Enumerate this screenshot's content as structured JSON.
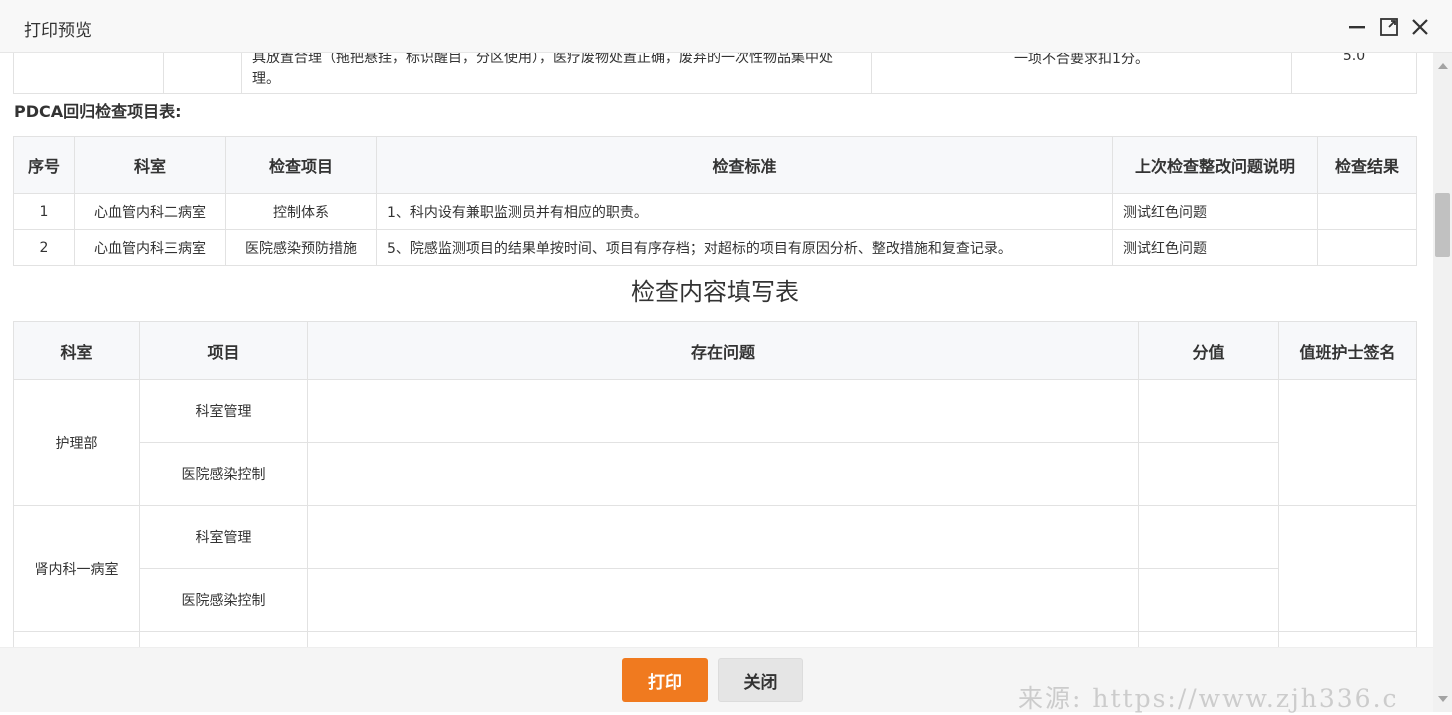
{
  "dialog": {
    "title": "打印预览"
  },
  "top_table": {
    "row": {
      "standard": "具放置合理（拖把悬挂，标识醒目，分区使用），医疗废物处置正确，废弃的一次性物品集中处理。",
      "rule": "一项不合要求扣1分。",
      "score": "5.0"
    }
  },
  "pdca": {
    "title": "PDCA回归检查项目表:",
    "headers": [
      "序号",
      "科室",
      "检查项目",
      "检查标准",
      "上次检查整改问题说明",
      "检查结果"
    ],
    "rows": [
      {
        "no": "1",
        "dept": "心血管内科二病室",
        "item": "控制体系",
        "standard": "1、科内设有兼职监测员并有相应的职责。",
        "note": "测试红色问题",
        "result": ""
      },
      {
        "no": "2",
        "dept": "心血管内科三病室",
        "item": "医院感染预防措施",
        "standard": "5、院感监测项目的结果单按时间、项目有序存档；对超标的项目有原因分析、整改措施和复查记录。",
        "note": "测试红色问题",
        "result": ""
      }
    ]
  },
  "fill_form": {
    "title": "检查内容填写表",
    "headers": [
      "科室",
      "项目",
      "存在问题",
      "分值",
      "值班护士签名"
    ],
    "groups": [
      {
        "dept": "护理部",
        "items": [
          "科室管理",
          "医院感染控制"
        ]
      },
      {
        "dept": "肾内科一病室",
        "items": [
          "科室管理",
          "医院感染控制"
        ]
      }
    ]
  },
  "footer": {
    "print_label": "打印",
    "close_label": "关闭"
  },
  "watermark": "来源: https://www.zjh336.c",
  "colors": {
    "primary_button": "#f07a1f",
    "header_bg": "#f7f8fa"
  }
}
